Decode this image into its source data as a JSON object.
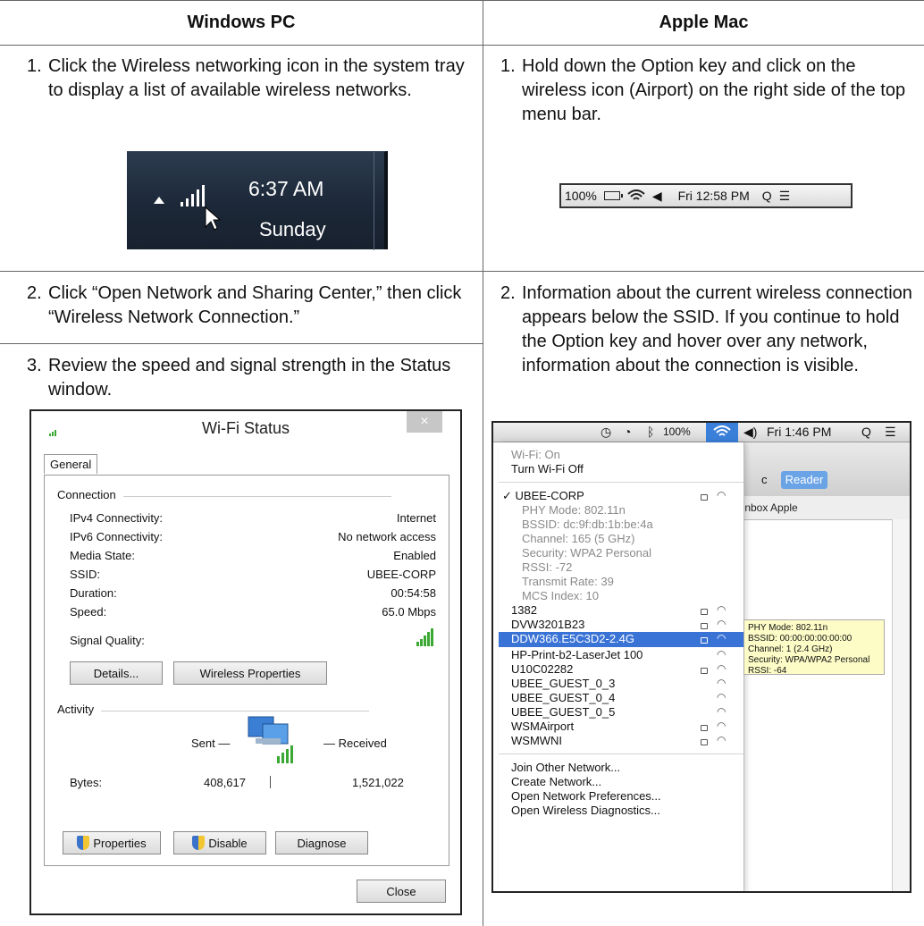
{
  "headers": {
    "windows": "Windows PC",
    "mac": "Apple Mac"
  },
  "windows": {
    "step1": {
      "num": "1.",
      "text": "Click the Wireless networking icon in the system tray to display a list of available wireless networks."
    },
    "tray": {
      "time": "6:37 AM",
      "day": "Sunday"
    },
    "step2": {
      "num": "2.",
      "text": "Click “Open Network and Sharing Center,” then click “Wireless Network Connection.”"
    },
    "step3": {
      "num": "3.",
      "text": "Review the speed and signal strength in the Status window."
    },
    "dialog": {
      "title": "Wi-Fi Status",
      "close_x": "×",
      "tab": "General",
      "connection_group": "Connection",
      "rows": [
        {
          "label": "IPv4 Connectivity:",
          "value": "Internet"
        },
        {
          "label": "IPv6 Connectivity:",
          "value": "No network access"
        },
        {
          "label": "Media State:",
          "value": "Enabled"
        },
        {
          "label": "SSID:",
          "value": "UBEE-CORP"
        },
        {
          "label": "Duration:",
          "value": "00:54:58"
        },
        {
          "label": "Speed:",
          "value": "65.0 Mbps"
        }
      ],
      "signal_quality_label": "Signal Quality:",
      "details_button": "Details...",
      "wireless_properties_button": "Wireless Properties",
      "activity_group": "Activity",
      "sent_label": "Sent —",
      "received_label": "— Received",
      "bytes_label": "Bytes:",
      "bytes_sent": "408,617",
      "bytes_received": "1,521,022",
      "properties_button": "Properties",
      "disable_button": "Disable",
      "diagnose_button": "Diagnose",
      "close_button": "Close"
    }
  },
  "mac": {
    "step1": {
      "num": "1.",
      "text": "Hold down the Option key and click on the wireless icon (Airport) on the right side of the top menu bar."
    },
    "menubar": {
      "battery": "100%",
      "volume": "◀",
      "time": "Fri 12:58 PM",
      "search": "Q",
      "list": "☰"
    },
    "step2": {
      "num": "2.",
      "text": "Information about the current wireless connection appears below the SSID. If you continue to hold the Option key and hover over any network, information about the connection is visible."
    },
    "screen": {
      "menubar": {
        "battery": "100%",
        "time": "Fri 1:46 PM",
        "search": "Q",
        "list": "☰",
        "volume": "◀)"
      },
      "browser": {
        "reader": "Reader",
        "reload": "c",
        "tabs": "Inbox   Apple"
      },
      "menu": {
        "wifi_status": "Wi-Fi: On",
        "turn_off": "Turn Wi-Fi Off",
        "current_network": "✓ UBEE-CORP",
        "details": [
          "PHY Mode: 802.11n",
          "BSSID: dc:9f:db:1b:be:4a",
          "Channel: 165 (5 GHz)",
          "Security: WPA2 Personal",
          "RSSI: -72",
          "Transmit Rate: 39",
          "MCS Index: 10"
        ],
        "networks": [
          "1382",
          "DVW3201B23",
          "DDW366.E5C3D2-2.4G",
          "HP-Print-b2-LaserJet 100",
          "U10C02282",
          "UBEE_GUEST_0_3",
          "UBEE_GUEST_0_4",
          "UBEE_GUEST_0_5",
          "WSMAirport",
          "WSMWNI"
        ],
        "actions": [
          "Join Other Network...",
          "Create Network...",
          "Open Network Preferences...",
          "Open Wireless Diagnostics..."
        ]
      },
      "tooltip": [
        "PHY Mode: 802.11n",
        "BSSID: 00:00:00:00:00:00",
        "Channel: 1 (2.4 GHz)",
        "Security: WPA/WPA2 Personal",
        "RSSI: -64"
      ]
    }
  },
  "colors": {
    "highlight": "#3973d6",
    "tooltip": "#fdfcc7",
    "signal_green": "#3aa832"
  }
}
